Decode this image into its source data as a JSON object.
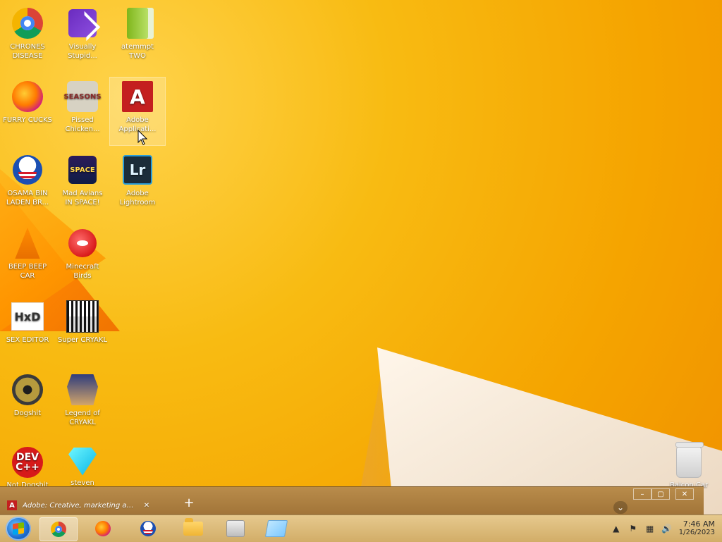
{
  "desktop": {
    "icons": [
      {
        "label": "CHRONES\nDISEASE",
        "icon": "chrome-icon"
      },
      {
        "label": "Visually\nStupid...",
        "icon": "visual-studio-icon"
      },
      {
        "label": "atemmpt\nTWO",
        "icon": "green-folder-icon"
      },
      {
        "label": "FURRY CUCKS",
        "icon": "firefox-icon"
      },
      {
        "label": "Pissed\nChicken...",
        "icon": "angry-birds-seasons-icon"
      },
      {
        "label": "Adobe\nApplicati...",
        "icon": "adobe-icon"
      },
      {
        "label": "OSAMA BIN\nLADEN BR...",
        "icon": "obama-logo-icon"
      },
      {
        "label": "Mad Avians\nIN SPACE!",
        "icon": "angry-birds-space-icon"
      },
      {
        "label": "Adobe\nLightroom",
        "icon": "lightroom-icon"
      },
      {
        "label": "BEEP BEEP\nCAR",
        "icon": "vlc-cone-icon"
      },
      {
        "label": "Minecraft\nBirds",
        "icon": "angry-bird-icon"
      },
      {
        "label": "SEX EDITOR",
        "icon": "hxd-icon"
      },
      {
        "label": "Super CRYAKL",
        "icon": "pixel-art-icon"
      },
      {
        "label": "Dogshit",
        "icon": "cpp-disc-icon"
      },
      {
        "label": "Legend of\nCRYAKL",
        "icon": "pixel-character-icon"
      },
      {
        "label": "Not Dogshit",
        "icon": "devcpp-icon"
      },
      {
        "label": "steven",
        "icon": "diamond-icon"
      },
      {
        "label": "Balcon Car",
        "icon": "recycle-bin-icon"
      }
    ]
  },
  "browser": {
    "tab_title": "Adobe: Creative, marketing and do",
    "tab_close": "✕",
    "new_tab": "+",
    "chevron": "⌄",
    "window_controls": {
      "minimize": "–",
      "restore": "▢",
      "close": "✕"
    }
  },
  "taskbar": {
    "items": [
      {
        "name": "chrome",
        "active": true
      },
      {
        "name": "firefox",
        "active": false
      },
      {
        "name": "obama",
        "active": false
      },
      {
        "name": "explorer",
        "active": false
      },
      {
        "name": "app",
        "active": false
      },
      {
        "name": "glass",
        "active": false
      }
    ],
    "tray": {
      "up_arrow": "▲",
      "flag": "⚑",
      "network": "▦",
      "volume": "🔊",
      "time": "7:46 AM",
      "date": "1/26/2023"
    }
  }
}
